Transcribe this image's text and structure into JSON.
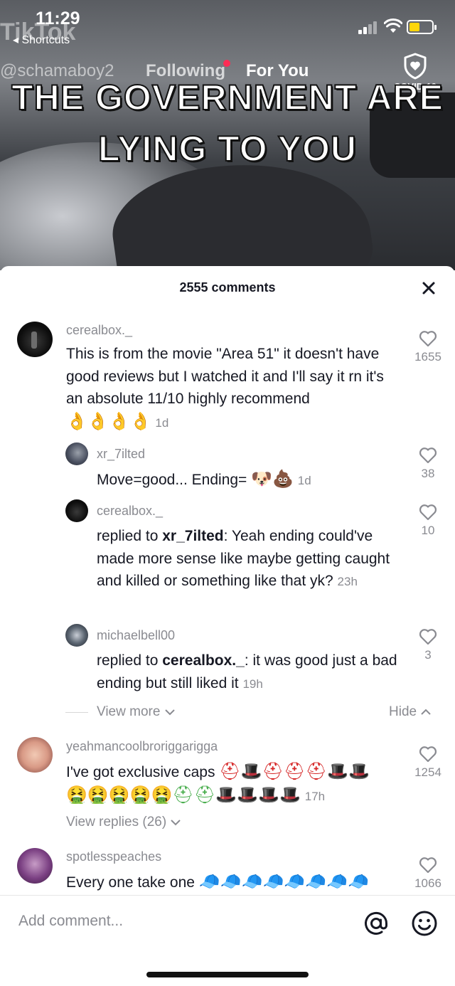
{
  "status_bar": {
    "time": "11:29",
    "back_label": "Shortcuts",
    "battery_color": "#ffd60a"
  },
  "video": {
    "watermark_logo": "TikTok",
    "watermark_user": "@schamaboy2",
    "tab_following": "Following",
    "tab_for_you": "For You",
    "covid_label": "COVID-19",
    "caption_line1": "THE GOVERNMENT ARE",
    "caption_line2": "LYING TO YOU"
  },
  "comments_panel": {
    "title": "2555 comments",
    "close_icon": "close-icon",
    "comments": [
      {
        "username": "cerealbox._",
        "text": "This is from the movie \"Area 51\" it doesn't have good reviews but I watched it and I'll say it rn it's an absolute 11/10 highly recommend",
        "emojis": "👌👌👌👌",
        "time": "1d",
        "likes": "1655",
        "replies": [
          {
            "username": "xr_7ilted",
            "text": "Move=good... Ending=",
            "emojis": "🐶💩",
            "time": "1d",
            "likes": "38"
          },
          {
            "username": "cerealbox._",
            "prefix": "replied to ",
            "mention": "xr_7ilted",
            "text": ": Yeah ending could've made more sense like maybe getting caught and killed or something like that yk?",
            "time": "23h",
            "likes": "10"
          },
          {
            "username": "michaelbell00",
            "prefix": "replied to ",
            "mention": "cerealbox._",
            "text": ": it was good just a bad ending but still liked it",
            "time": "19h",
            "likes": "3"
          }
        ],
        "view_more": "View more",
        "hide": "Hide"
      },
      {
        "username": "yeahmancoolbroriggarigga",
        "text": "I've got exclusive caps",
        "emojis_line1": "⛑🎩⛑⛑⛑🎩🎩",
        "emojis_line2": "🤮🤮🤮🤮🤮⛑⛑🎩🎩🎩🎩",
        "time": "17h",
        "likes": "1254",
        "view_replies": "View replies (26)"
      },
      {
        "username": "spotlesspeaches",
        "text": "Every one take one",
        "emojis": "🧢🧢🧢🧢🧢🧢🧢🧢",
        "likes": "1066"
      }
    ]
  },
  "input_bar": {
    "placeholder": "Add comment...",
    "mention_icon": "at-icon",
    "emoji_icon": "smiley-icon"
  }
}
